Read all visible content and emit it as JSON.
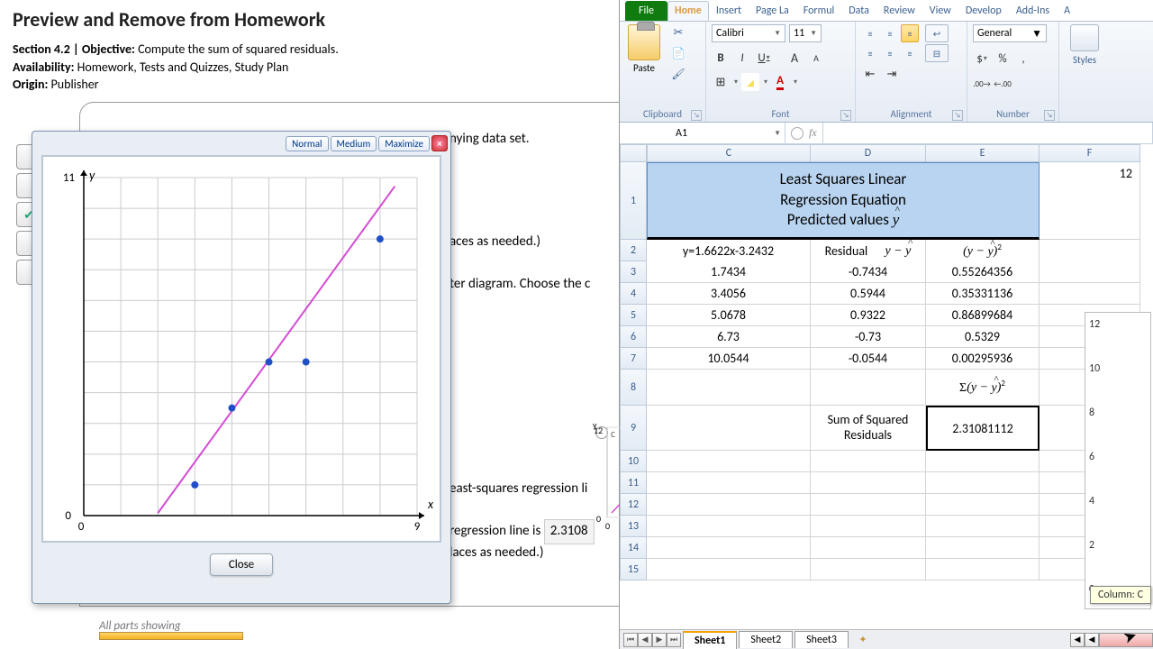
{
  "hw": {
    "title": "Preview and Remove from Homework",
    "section_label": "Section 4.2 | Objective:",
    "section_text": "Compute the sum of squared residuals.",
    "availability_label": "Availability:",
    "availability_text": "Homework, Tests and Quizzes, Study Plan",
    "origin_label": "Origin:",
    "origin_text": "Publisher"
  },
  "snippets": {
    "s1": "nying data set.",
    "s2": "aces as needed.)",
    "s3": "ter diagram. Choose the c",
    "s4": "east-squares regression li",
    "s5": "regression line is",
    "s6": "laces as needed.)",
    "opt_c": "c"
  },
  "answer": "2.3108",
  "popup": {
    "normal": "Normal",
    "medium": "Medium",
    "max": "Maximize",
    "close": "Close"
  },
  "allparts": "All parts showing",
  "chart_data": {
    "type": "scatter",
    "title": "",
    "xlabel": "x",
    "ylabel": "y",
    "xlim": [
      0,
      9
    ],
    "ylim": [
      0,
      11
    ],
    "xticks": [
      0,
      9
    ],
    "yticks": [
      0,
      11
    ],
    "points": [
      {
        "x": 3,
        "y": 1
      },
      {
        "x": 4,
        "y": 3.5
      },
      {
        "x": 5,
        "y": 5
      },
      {
        "x": 6,
        "y": 5
      },
      {
        "x": 8,
        "y": 9
      }
    ],
    "line": {
      "slope": 1.6622,
      "intercept": -3.2432,
      "color": "#d44cd4"
    }
  },
  "mini_chart": {
    "xmax": 9,
    "ymax": 12,
    "xlbl": "x",
    "ylbl": "y"
  },
  "excel": {
    "tabs": [
      "File",
      "Home",
      "Insert",
      "Page La",
      "Formul",
      "Data",
      "Review",
      "View",
      "Develop",
      "Add-Ins",
      "A"
    ],
    "active_tab": "Home",
    "font_name": "Calibri",
    "font_size": "11",
    "number_format": "General",
    "groups": {
      "clipboard": "Clipboard",
      "font": "Font",
      "alignment": "Alignment",
      "number": "Number",
      "styles": "Styles"
    },
    "paste": "Paste",
    "namebox": "A1",
    "fx": "fx",
    "cols": [
      "C",
      "D",
      "E",
      "F"
    ],
    "header_cell": {
      "l1": "Least Squares Linear",
      "l2": "Regression Equation",
      "l3": "Predicted values"
    },
    "row2": {
      "C": "y=1.6622x-3.2432",
      "D": "Residual",
      "D2": "y − ŷ",
      "E": "(y − ŷ)²"
    },
    "data_rows": [
      {
        "n": "3",
        "C": "1.7434",
        "D": "-0.7434",
        "E": "0.55264356"
      },
      {
        "n": "4",
        "C": "3.4056",
        "D": "0.5944",
        "E": "0.35331136"
      },
      {
        "n": "5",
        "C": "5.0678",
        "D": "0.9322",
        "E": "0.86899684"
      },
      {
        "n": "6",
        "C": "6.73",
        "D": "-0.73",
        "E": "0.5329"
      },
      {
        "n": "7",
        "C": "10.0544",
        "D": "-0.0544",
        "E": "0.00295936"
      }
    ],
    "row8_E": "Σ(y − ŷ)²",
    "sum_label": "Sum of Squared Residuals",
    "sum_value": "2.31081112",
    "sheets": [
      "Sheet1",
      "Sheet2",
      "Sheet3"
    ],
    "chart_y": [
      "12",
      "10",
      "8",
      "6",
      "4",
      "2",
      "0"
    ],
    "chart_x0": "0",
    "col_indicator": "Column: C"
  }
}
